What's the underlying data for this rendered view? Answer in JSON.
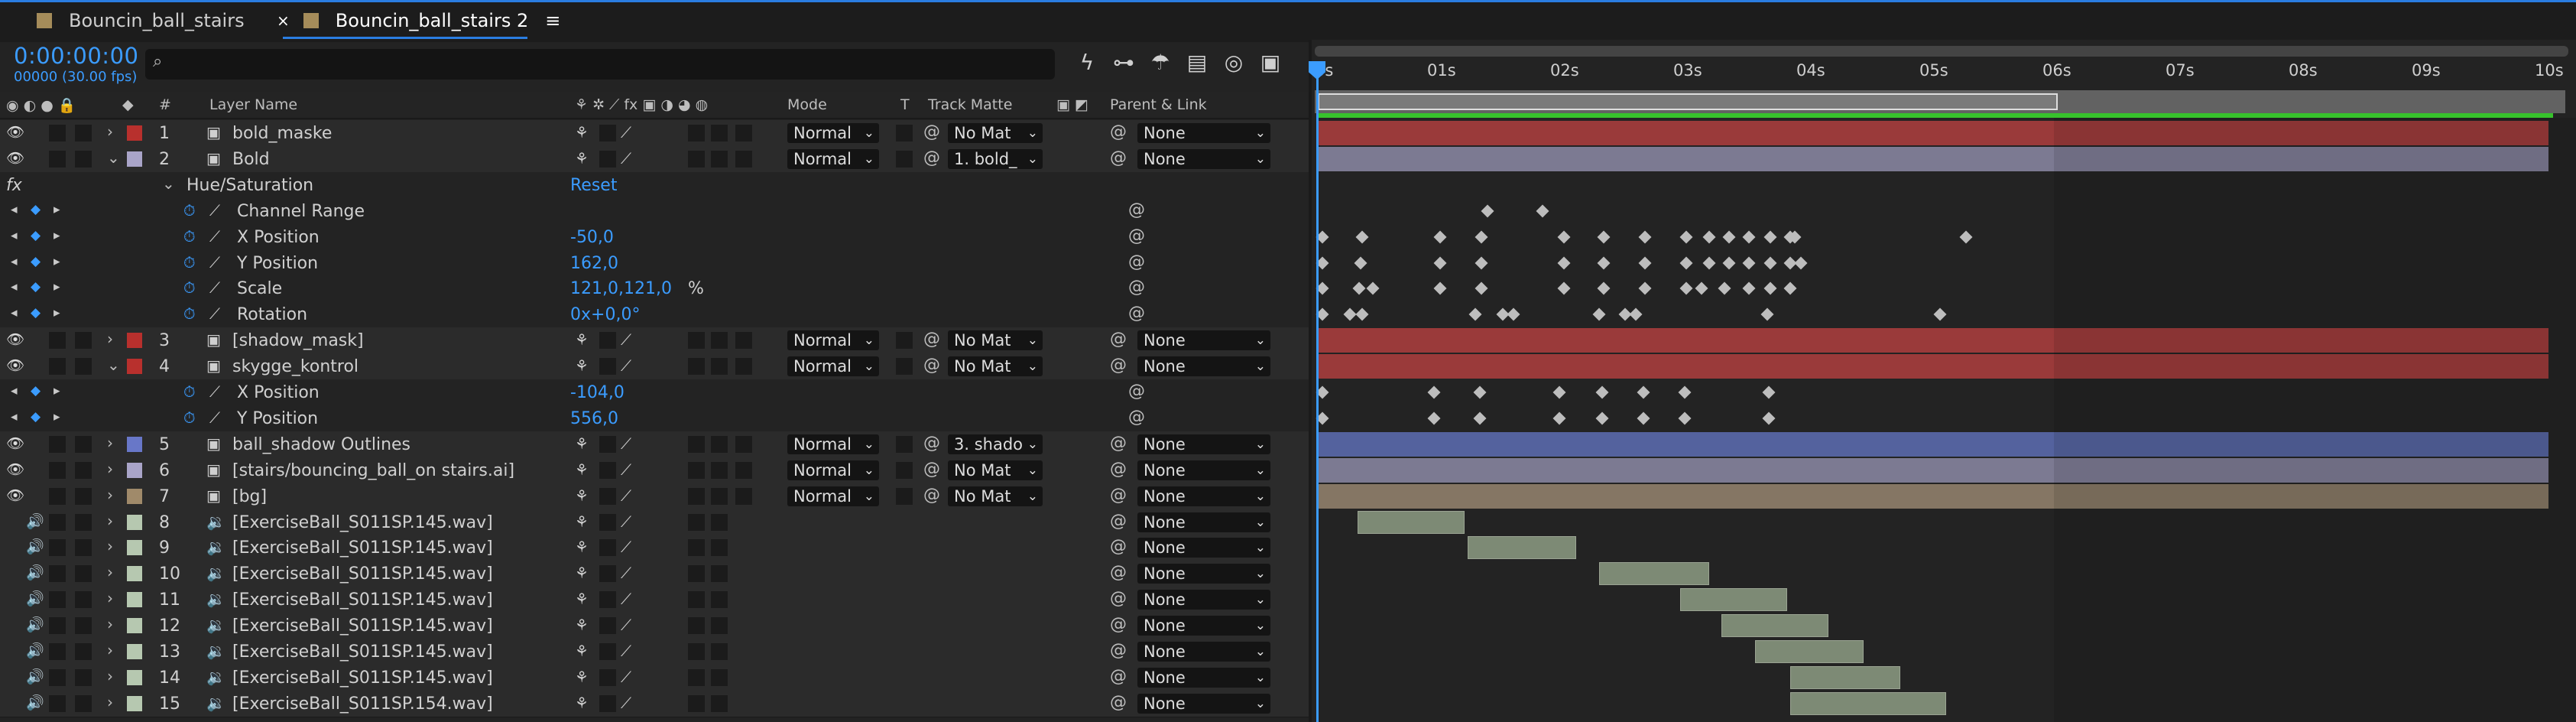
{
  "tabs": [
    {
      "label": "Bouncin_ball_stairs"
    },
    {
      "label": "Bouncin_ball_stairs 2"
    }
  ],
  "tab_menu": "≡",
  "timecode": "0:00:00:00",
  "fps": "00000 (30.00 fps)",
  "search": {
    "placeholder": "",
    "icon": "search-icon"
  },
  "columns": {
    "num": "#",
    "layer_name": "Layer Name",
    "mode": "Mode",
    "t": "T",
    "track_matte": "Track Matte",
    "parent": "Parent & Link"
  },
  "ruler": [
    "0s",
    "01s",
    "02s",
    "03s",
    "04s",
    "05s",
    "06s",
    "07s",
    "08s",
    "09s",
    "10s"
  ],
  "rows": [
    {
      "kind": "layer",
      "num": "1",
      "name": "bold_maske",
      "label_color": "#b8302d",
      "mode": "Normal",
      "matte": "No Mat",
      "parent": "None"
    },
    {
      "kind": "layer",
      "num": "2",
      "name": "Bold",
      "label_color": "#a9a4c8",
      "mode": "Normal",
      "matte": "1. bold_",
      "parent": "None",
      "open": true
    },
    {
      "kind": "fx",
      "name": "Hue/Saturation",
      "value": "Reset"
    },
    {
      "kind": "prop",
      "name": "Channel Range",
      "value": ""
    },
    {
      "kind": "prop",
      "name": "X Position",
      "value": "-50,0"
    },
    {
      "kind": "prop",
      "name": "Y Position",
      "value": "162,0"
    },
    {
      "kind": "prop",
      "name": "Scale",
      "value": "121,0,121,0",
      "unit": "%"
    },
    {
      "kind": "prop",
      "name": "Rotation",
      "value": "0x+0,0°"
    },
    {
      "kind": "layer",
      "num": "3",
      "name": "[shadow_mask]",
      "label_color": "#b8302d",
      "mode": "Normal",
      "matte": "No Mat",
      "parent": "None"
    },
    {
      "kind": "layer",
      "num": "4",
      "name": "skygge_kontrol",
      "label_color": "#b8302d",
      "mode": "Normal",
      "matte": "No Mat",
      "parent": "None",
      "open": true
    },
    {
      "kind": "prop",
      "name": "X Position",
      "value": "-104,0"
    },
    {
      "kind": "prop",
      "name": "Y Position",
      "value": "556,0"
    },
    {
      "kind": "layer",
      "num": "5",
      "name": "ball_shadow Outlines",
      "label_color": "#6877c8",
      "mode": "Normal",
      "matte": "3. shado",
      "parent": "None"
    },
    {
      "kind": "layer",
      "num": "6",
      "name": "[stairs/bouncing_ball_on stairs.ai]",
      "label_color": "#a9a4c8",
      "mode": "Normal",
      "matte": "No Mat",
      "parent": "None"
    },
    {
      "kind": "layer",
      "num": "7",
      "name": "[bg]",
      "label_color": "#a08a6a",
      "mode": "Normal",
      "matte": "No Mat",
      "parent": "None"
    },
    {
      "kind": "audio",
      "num": "8",
      "name": "[ExerciseBall_S011SP.145.wav]",
      "label_color": "#b6c8b0",
      "parent": "None"
    },
    {
      "kind": "audio",
      "num": "9",
      "name": "[ExerciseBall_S011SP.145.wav]",
      "label_color": "#b6c8b0",
      "parent": "None"
    },
    {
      "kind": "audio",
      "num": "10",
      "name": "[ExerciseBall_S011SP.145.wav]",
      "label_color": "#b6c8b0",
      "parent": "None"
    },
    {
      "kind": "audio",
      "num": "11",
      "name": "[ExerciseBall_S011SP.145.wav]",
      "label_color": "#b6c8b0",
      "parent": "None"
    },
    {
      "kind": "audio",
      "num": "12",
      "name": "[ExerciseBall_S011SP.145.wav]",
      "label_color": "#b6c8b0",
      "parent": "None"
    },
    {
      "kind": "audio",
      "num": "13",
      "name": "[ExerciseBall_S011SP.145.wav]",
      "label_color": "#b6c8b0",
      "parent": "None"
    },
    {
      "kind": "audio",
      "num": "14",
      "name": "[ExerciseBall_S011SP.145.wav]",
      "label_color": "#b6c8b0",
      "parent": "None"
    },
    {
      "kind": "audio",
      "num": "15",
      "name": "[ExerciseBall_S011SP.154.wav]",
      "label_color": "#b6c8b0",
      "parent": "None"
    }
  ],
  "colors": {
    "accent": "#3b9cff",
    "layer_red": "#9a3a3a",
    "layer_lavender": "#7c7a92",
    "layer_blue": "#54629e",
    "layer_tan": "#857664",
    "audio": "#7d8a75",
    "workarea_green": "#37c22c"
  }
}
